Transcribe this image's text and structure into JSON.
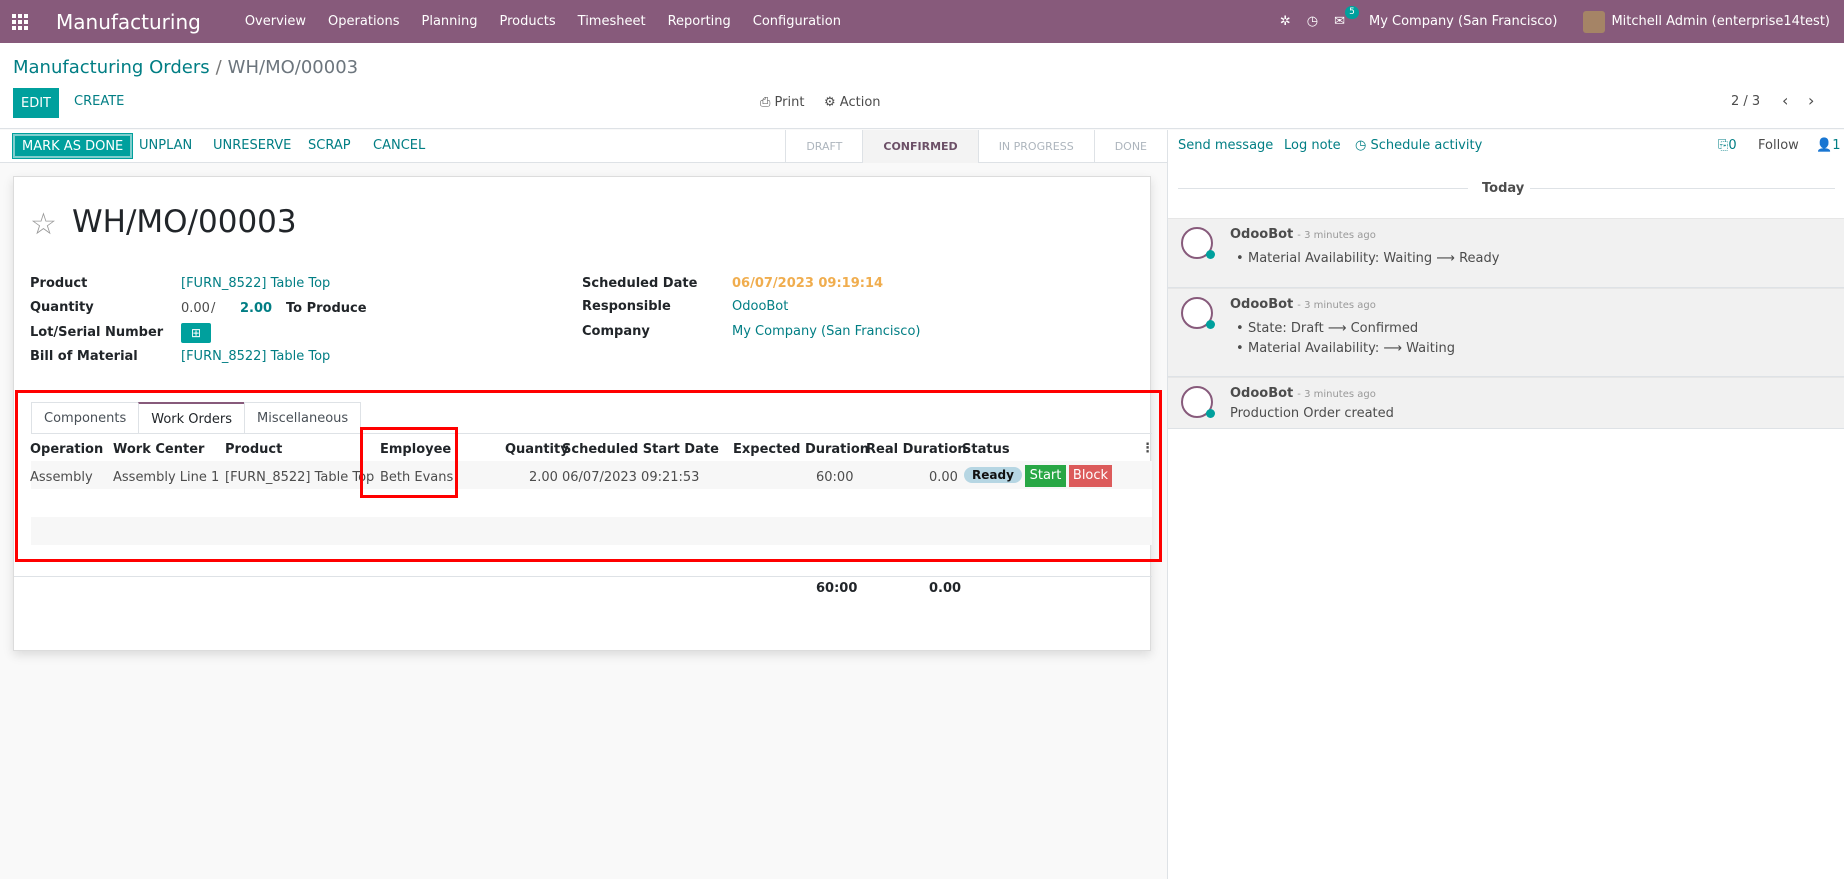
{
  "navbar": {
    "app_name": "Manufacturing",
    "menu": [
      "Overview",
      "Operations",
      "Planning",
      "Products",
      "Timesheet",
      "Reporting",
      "Configuration"
    ],
    "messages_count": "5",
    "company": "My Company (San Francisco)",
    "user": "Mitchell Admin (enterprise14test)"
  },
  "breadcrumb": {
    "parent": "Manufacturing Orders",
    "separator": "/",
    "current": "WH/MO/00003"
  },
  "toolbar": {
    "edit": "EDIT",
    "create": "CREATE",
    "print": "Print",
    "action": "Action",
    "pager": "2 / 3"
  },
  "statusbar": {
    "buttons": [
      "MARK AS DONE",
      "UNPLAN",
      "UNRESERVE",
      "SCRAP",
      "CANCEL"
    ],
    "states": [
      "DRAFT",
      "CONFIRMED",
      "IN PROGRESS",
      "DONE"
    ],
    "active_state": "CONFIRMED"
  },
  "form": {
    "title": "WH/MO/00003",
    "product_label": "Product",
    "product": "[FURN_8522] Table Top",
    "quantity_label": "Quantity",
    "qty_produced": "0.00",
    "qty_sep": "/",
    "qty_to_produce": "2.00",
    "to_produce_label": "To Produce",
    "lot_label": "Lot/Serial Number",
    "bom_label": "Bill of Material",
    "bom": "[FURN_8522] Table Top",
    "scheduled_label": "Scheduled Date",
    "scheduled": "06/07/2023 09:19:14",
    "responsible_label": "Responsible",
    "responsible": "OdooBot",
    "company_label": "Company",
    "company": "My Company (San Francisco)"
  },
  "tabs": [
    "Components",
    "Work Orders",
    "Miscellaneous"
  ],
  "workorders": {
    "headers": [
      "Operation",
      "Work Center",
      "Product",
      "Employee",
      "Quantity",
      "Scheduled Start Date",
      "Expected Duration",
      "Real Duration",
      "Status"
    ],
    "row": {
      "operation": "Assembly",
      "work_center": "Assembly Line 1",
      "product": "[FURN_8522] Table Top",
      "employee": "Beth Evans",
      "quantity": "2.00",
      "start": "06/07/2023 09:21:53",
      "expected": "60:00",
      "real": "0.00",
      "status": "Ready",
      "start_btn": "Start",
      "block_btn": "Block"
    },
    "totals": {
      "expected": "60:00",
      "real": "0.00"
    }
  },
  "chatter": {
    "send_message": "Send message",
    "log_note": "Log note",
    "schedule": "Schedule activity",
    "attachments": "0",
    "follow": "Follow",
    "followers": "1",
    "day": "Today",
    "messages": [
      {
        "author": "OdooBot",
        "when": "- 3 minutes ago",
        "lines": [
          "Material Availability: Waiting ⟶ Ready"
        ]
      },
      {
        "author": "OdooBot",
        "when": "- 3 minutes ago",
        "lines": [
          "State: Draft ⟶ Confirmed",
          "Material Availability: ⟶ Waiting"
        ]
      },
      {
        "author": "OdooBot",
        "when": "- 3 minutes ago",
        "text": "Production Order created"
      }
    ]
  },
  "colors": {
    "brand": "#875a7b",
    "accent": "#00a09d",
    "link": "#017e84",
    "highlight": "#ff0000",
    "scheduled": "#f0ad4e"
  }
}
